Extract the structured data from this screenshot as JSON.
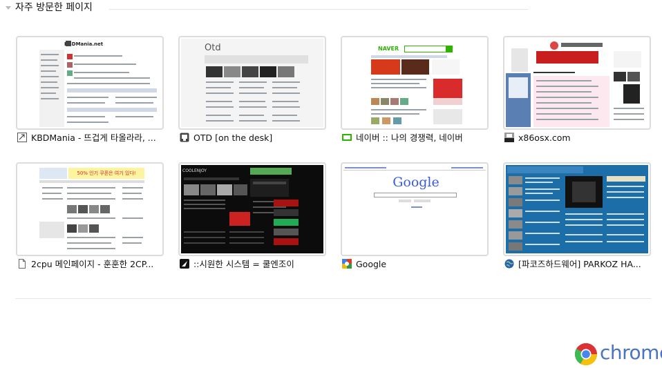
{
  "section": {
    "title": "자주 방문한 페이지"
  },
  "tiles": [
    {
      "title": "KBDMania - 뜨겁게 타올라라, ...",
      "favicon": "kbdmania-favicon",
      "site_text": "KBDMania.net"
    },
    {
      "title": "OTD [on the desk]",
      "favicon": "otd-favicon",
      "site_text": "Otd"
    },
    {
      "title": "네이버 :: 나의 경쟁력, 네이버",
      "favicon": "naver-favicon",
      "site_text": "NAVER"
    },
    {
      "title": "x86osx.com",
      "favicon": "x86osx-favicon"
    },
    {
      "title": "2cpu 메인페이지 - 훈훈한 2CP...",
      "favicon": "generic-page-icon",
      "site_text": "50% 인기 쿠폰은 여기 있다!"
    },
    {
      "title": "::시원한 시스템 = 쿨엔조이",
      "favicon": "coolenjoy-favicon",
      "site_text": "COOLENJOY"
    },
    {
      "title": "Google",
      "favicon": "google-favicon",
      "site_text": "Google"
    },
    {
      "title": "[파코즈하드웨어] PARKOZ HA...",
      "favicon": "parkoz-favicon"
    }
  ],
  "brand": {
    "wordmark": "chrome",
    "logo": "chrome-logo-icon"
  },
  "colors": {
    "accent": "#4a73c4",
    "naver_green": "#2db400",
    "border": "#dcdcdc"
  }
}
